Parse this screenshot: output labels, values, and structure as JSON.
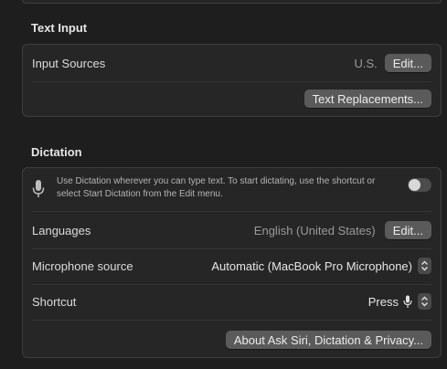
{
  "text_input": {
    "section_title": "Text Input",
    "input_sources_label": "Input Sources",
    "input_sources_value": "U.S.",
    "edit_label": "Edit...",
    "text_replacements_label": "Text Replacements..."
  },
  "dictation": {
    "section_title": "Dictation",
    "description": "Use Dictation wherever you can type text. To start dictating, use the shortcut or select Start Dictation from the Edit menu.",
    "toggle_on": false,
    "languages_label": "Languages",
    "languages_value": "English (United States)",
    "edit_label": "Edit...",
    "microphone_label": "Microphone source",
    "microphone_value": "Automatic (MacBook Pro Microphone)",
    "shortcut_label": "Shortcut",
    "shortcut_value": "Press",
    "shortcut_icon": "microphone-icon",
    "about_label": "About Ask Siri, Dictation & Privacy..."
  }
}
